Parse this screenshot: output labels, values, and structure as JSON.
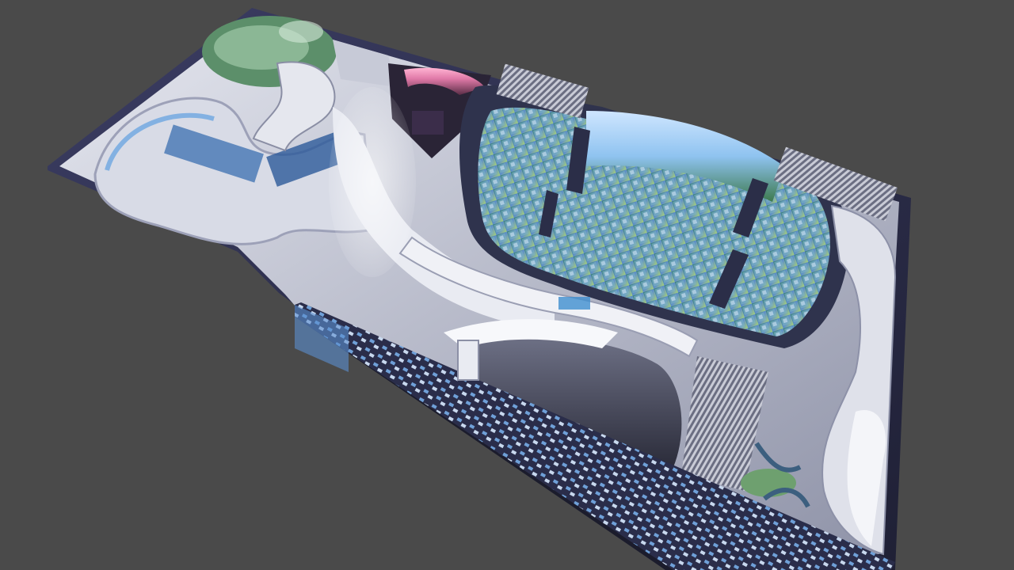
{
  "scene": {
    "description_words": [],
    "background_color": "#4a4a4a",
    "floor_color": "#c9cbd6",
    "wall_color": "#2e2f4a",
    "accent_blue": "#3f8fd0",
    "sky_blue": "#8fc3f0",
    "city_green": "#5fa67a",
    "theater_pink": "#e07aa8",
    "logo_text": "",
    "icons": [
      "exhibition-hall-floorplan-render"
    ]
  }
}
